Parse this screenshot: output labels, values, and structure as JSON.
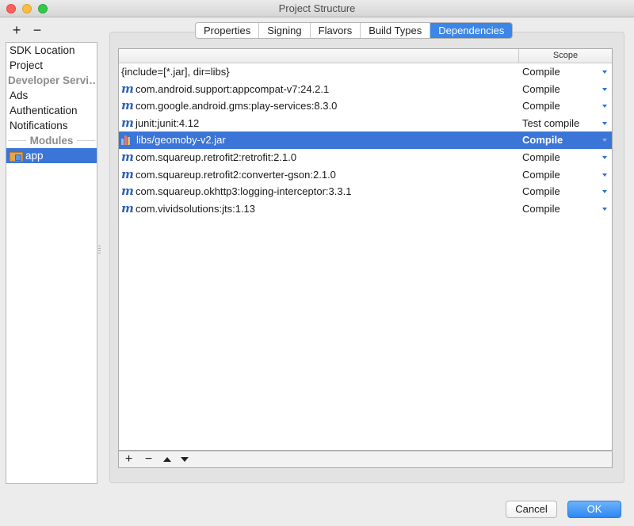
{
  "window": {
    "title": "Project Structure"
  },
  "left_toolbar": {
    "add": "+",
    "remove": "−"
  },
  "sidebar": {
    "items": [
      {
        "label": "SDK Location"
      },
      {
        "label": "Project"
      }
    ],
    "section_header": "Developer Servi…",
    "section_items": [
      {
        "label": "Ads"
      },
      {
        "label": "Authentication"
      },
      {
        "label": "Notifications"
      }
    ],
    "modules_header": "Modules",
    "modules": [
      {
        "label": "app",
        "icon": "module-folder-icon",
        "selected": true
      }
    ]
  },
  "tabs": [
    {
      "label": "Properties"
    },
    {
      "label": "Signing"
    },
    {
      "label": "Flavors"
    },
    {
      "label": "Build Types"
    },
    {
      "label": "Dependencies",
      "active": true
    }
  ],
  "table": {
    "columns": [
      "",
      "Scope"
    ],
    "rows": [
      {
        "name": "{include=[*.jar], dir=libs}",
        "scope": "Compile",
        "icon": "none"
      },
      {
        "name": "com.android.support:appcompat-v7:24.2.1",
        "scope": "Compile",
        "icon": "maven-icon"
      },
      {
        "name": "com.google.android.gms:play-services:8.3.0",
        "scope": "Compile",
        "icon": "maven-icon"
      },
      {
        "name": "junit:junit:4.12",
        "scope": "Test compile",
        "icon": "maven-icon"
      },
      {
        "name": "libs/geomoby-v2.jar",
        "scope": "Compile",
        "icon": "jar-icon",
        "selected": true
      },
      {
        "name": "com.squareup.retrofit2:retrofit:2.1.0",
        "scope": "Compile",
        "icon": "maven-icon"
      },
      {
        "name": "com.squareup.retrofit2:converter-gson:2.1.0",
        "scope": "Compile",
        "icon": "maven-icon"
      },
      {
        "name": "com.squareup.okhttp3:logging-interceptor:3.3.1",
        "scope": "Compile",
        "icon": "maven-icon"
      },
      {
        "name": "com.vividsolutions:jts:1.13",
        "scope": "Compile",
        "icon": "maven-icon"
      }
    ],
    "maven_glyph": "m"
  },
  "table_toolbar": {
    "add": "+",
    "remove": "−"
  },
  "buttons": {
    "cancel": "Cancel",
    "ok": "OK"
  },
  "colors": {
    "selection": "#3b75d7",
    "active_tab": "#3b86e8",
    "ok_button": "#2e87f3"
  }
}
